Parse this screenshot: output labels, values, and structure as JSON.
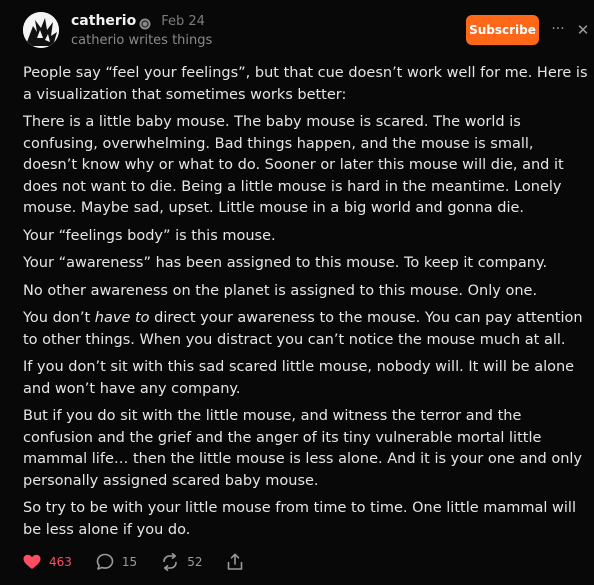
{
  "post": {
    "author": "catherio",
    "date": "Feb 24",
    "subtitle": "catherio writes things",
    "subscribe_label": "Subscribe",
    "more_label": "···",
    "close_label": "✕",
    "paragraphs": [
      "People say “feel your feelings”, but that cue doesn’t work well for me. Here is a visualization that sometimes works better:",
      "There is a little baby mouse. The baby mouse is scared. The world is confusing, overwhelming. Bad things happen, and the mouse is small, doesn’t know why or what to do. Sooner or later this mouse will die, and it does not want to die. Being a little mouse is hard in the meantime. Lonely mouse. Maybe sad, upset. Little mouse in a big world and gonna die.",
      "Your “feelings body” is this mouse.",
      "Your “awareness” has been assigned to this mouse. To keep it company.",
      "No other awareness on the planet is assigned to this mouse. Only one.",
      {
        "before": "You don’t ",
        "emph": "have to",
        "after": " direct your awareness to the mouse. You can pay attention to other things. When you distract you can’t notice the mouse much at all."
      },
      "If you don’t sit with this sad scared little mouse, nobody will. It will be alone and won’t have any company.",
      "But if you do sit with the little mouse, and witness the terror and the confusion and the grief and the anger of its tiny vulnerable mortal little mammal life… then the little mouse is less alone. And it is your one and only personally assigned scared baby mouse.",
      "So try to be with your little mouse from time to time. One little mammal will be less alone if you do."
    ]
  },
  "actions": {
    "likes": "463",
    "comments": "15",
    "restacks": "52"
  },
  "colors": {
    "accent": "#ff6719",
    "like": "#ff4d61",
    "background": "#080808"
  },
  "icons": [
    "verified-badge-icon",
    "more-icon",
    "close-icon",
    "heart-icon",
    "comment-icon",
    "restack-icon",
    "share-icon"
  ]
}
